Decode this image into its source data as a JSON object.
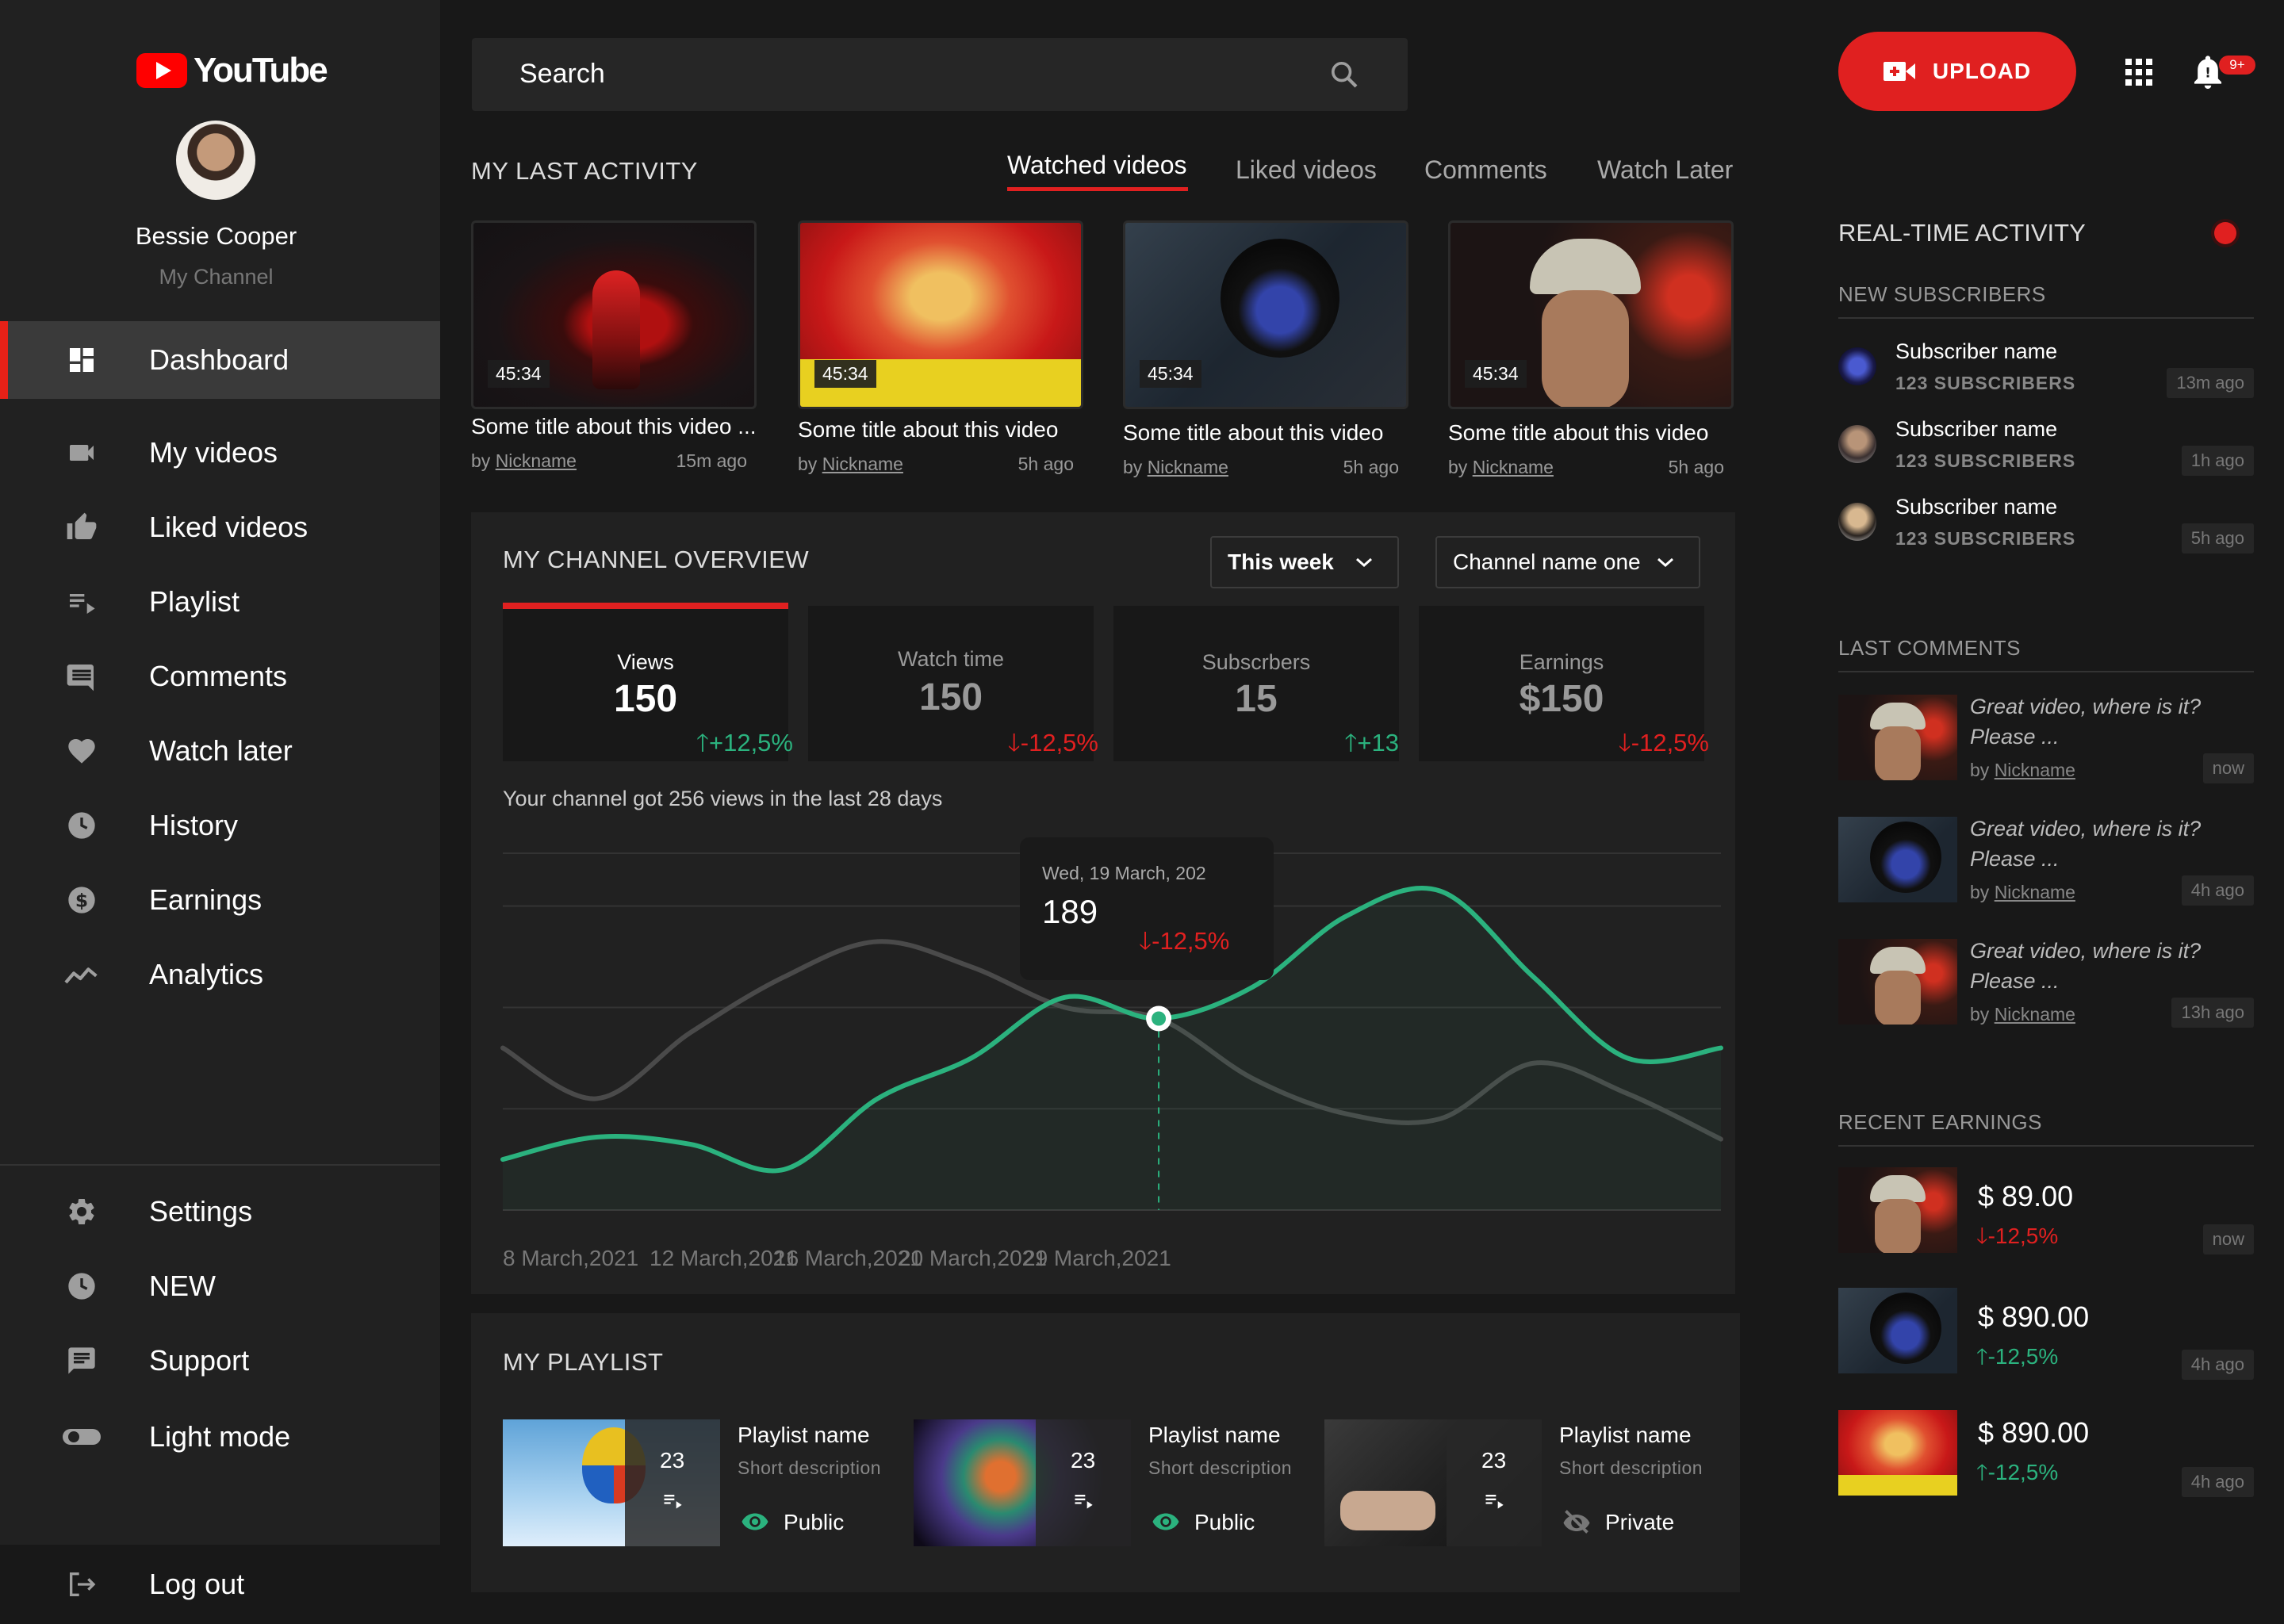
{
  "app": {
    "logo_text": "YouTube"
  },
  "user": {
    "name": "Bessie Cooper",
    "subtitle": "My Channel"
  },
  "nav": {
    "items": [
      {
        "label": "Dashboard",
        "icon": "dashboard-icon",
        "active": true
      },
      {
        "label": "My videos",
        "icon": "videocam-icon"
      },
      {
        "label": "Liked videos",
        "icon": "thumb-up-icon"
      },
      {
        "label": "Playlist",
        "icon": "playlist-icon"
      },
      {
        "label": "Comments",
        "icon": "comment-icon"
      },
      {
        "label": "Watch later",
        "icon": "heart-icon"
      },
      {
        "label": "History",
        "icon": "clock-icon"
      },
      {
        "label": "Earnings",
        "icon": "dollar-icon"
      },
      {
        "label": "Analytics",
        "icon": "trend-icon"
      }
    ],
    "bottom": [
      {
        "label": "Settings",
        "icon": "gear-icon"
      },
      {
        "label": "NEW",
        "icon": "clock-icon"
      },
      {
        "label": "Support",
        "icon": "chat-icon"
      },
      {
        "label": "Light mode",
        "icon": "toggle-icon"
      }
    ],
    "logout": "Log out"
  },
  "search": {
    "placeholder": "Search"
  },
  "topbar": {
    "upload": "UPLOAD",
    "notif_badge": "9+"
  },
  "activity": {
    "title": "MY LAST ACTIVITY",
    "tabs": [
      "Watched videos",
      "Liked videos",
      "Comments",
      "Watch Later"
    ],
    "videos": [
      {
        "title": "Some title about this video ...",
        "by": "by",
        "author": "Nickname",
        "time": "15m ago",
        "duration": "45:34"
      },
      {
        "title": "Some title about this video",
        "by": "by",
        "author": "Nickname",
        "time": "5h ago",
        "duration": "45:34"
      },
      {
        "title": "Some title about this video",
        "by": "by",
        "author": "Nickname",
        "time": "5h ago",
        "duration": "45:34"
      },
      {
        "title": "Some title about this video",
        "by": "by",
        "author": "Nickname",
        "time": "5h ago",
        "duration": "45:34"
      }
    ]
  },
  "overview": {
    "title": "MY CHANNEL OVERVIEW",
    "period": "This week",
    "channel": "Channel name one",
    "stats": [
      {
        "label": "Views",
        "value": "150",
        "change": "+12,5%",
        "dir": "up"
      },
      {
        "label": "Watch time",
        "value": "150",
        "change": "-12,5%",
        "dir": "down"
      },
      {
        "label": "Subscrbers",
        "value": "15",
        "change": "+13",
        "dir": "up"
      },
      {
        "label": "Earnings",
        "value": "$150",
        "change": "-12,5%",
        "dir": "down"
      }
    ],
    "caption": "Your channel got 256 views in the last 28 days",
    "tooltip": {
      "date": "Wed, 19 March, 202",
      "value": "189",
      "change": "-12,5%"
    }
  },
  "chart_data": {
    "type": "line",
    "title": "",
    "xlabel": "",
    "ylabel": "",
    "x_tick_labels": [
      "8 March,2021",
      "12 March,2021",
      "16 March,2021",
      "20 March,2021",
      "29 March,2021"
    ],
    "series": [
      {
        "name": "",
        "color": "#2bb27e",
        "values": [
          50,
          72,
          65,
          40,
          110,
          150,
          210,
          189,
          220,
          290,
          315,
          230,
          150,
          160
        ]
      },
      {
        "name": "",
        "color": "#4a4a4a",
        "values": [
          160,
          110,
          175,
          230,
          265,
          240,
          200,
          189,
          130,
          95,
          90,
          145,
          115,
          70
        ]
      }
    ],
    "highlight_index": 7,
    "grid": true
  },
  "playlist": {
    "title": "MY PLAYLIST",
    "items": [
      {
        "name": "Playlist name",
        "desc": "Short description",
        "count": "23",
        "visibility": "Public",
        "vis_icon": "eye-icon"
      },
      {
        "name": "Playlist name",
        "desc": "Short description",
        "count": "23",
        "visibility": "Public",
        "vis_icon": "eye-icon"
      },
      {
        "name": "Playlist name",
        "desc": "Short description",
        "count": "23",
        "visibility": "Private",
        "vis_icon": "eye-off-icon"
      }
    ]
  },
  "realtime": {
    "title": "REAL-TIME ACTIVITY",
    "subs_title": "NEW SUBSCRIBERS",
    "subscribers": [
      {
        "name": "Subscriber name",
        "count": "123 SUBSCRIBERS",
        "time": "13m ago"
      },
      {
        "name": "Subscriber name",
        "count": "123 SUBSCRIBERS",
        "time": "1h ago"
      },
      {
        "name": "Subscriber name",
        "count": "123 SUBSCRIBERS",
        "time": "5h ago"
      }
    ],
    "comments_title": "LAST COMMENTS",
    "comments": [
      {
        "text": "Great video, where is it? Please ...",
        "by": "by",
        "author": "Nickname",
        "time": "now"
      },
      {
        "text": "Great video, where is it? Please ...",
        "by": "by",
        "author": "Nickname",
        "time": "4h ago"
      },
      {
        "text": "Great video, where is it? Please ...",
        "by": "by",
        "author": "Nickname",
        "time": "13h ago"
      }
    ],
    "earnings_title": "RECENT EARNINGS",
    "earnings": [
      {
        "amount": "$ 89.00",
        "change": "-12,5%",
        "dir": "down",
        "time": "now"
      },
      {
        "amount": "$ 890.00",
        "change": "-12,5%",
        "dir": "up",
        "time": "4h ago"
      },
      {
        "amount": "$ 890.00",
        "change": "-12,5%",
        "dir": "up",
        "time": "4h ago"
      }
    ]
  }
}
